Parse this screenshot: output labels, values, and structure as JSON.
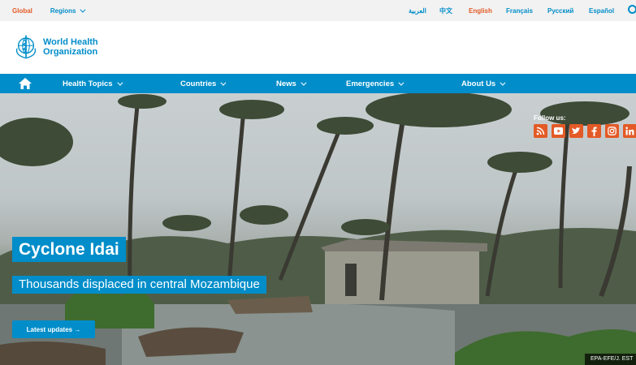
{
  "topbar": {
    "global": "Global",
    "regions": "Regions",
    "languages": [
      "العربية",
      "中文",
      "English",
      "Français",
      "Русский",
      "Español"
    ]
  },
  "logo": {
    "line1": "World Health",
    "line2": "Organization"
  },
  "nav": {
    "items": [
      "Health Topics",
      "Countries",
      "News",
      "Emergencies",
      "About Us"
    ]
  },
  "hero": {
    "follow_label": "Follow us:",
    "social": [
      "rss-icon",
      "youtube-icon",
      "twitter-icon",
      "facebook-icon",
      "instagram-icon",
      "linkedin-icon"
    ],
    "title": "Cyclone Idai",
    "subtitle": "Thousands displaced in central Mozambique",
    "cta": "Latest updates →",
    "credit": "EPA-EFE/J. EST"
  },
  "colors": {
    "brand_blue": "#008dc9",
    "accent_orange": "#e35a26"
  }
}
